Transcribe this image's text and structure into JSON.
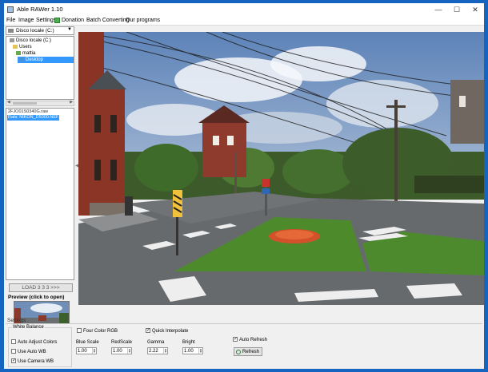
{
  "window": {
    "title": "Able RAWer 1.10"
  },
  "titlebar_controls": {
    "minimize": "—",
    "maximize": "☐",
    "close": "✕"
  },
  "menu": [
    "File",
    "Image",
    "Settings",
    "Donation",
    "Batch Converting",
    "Our programs"
  ],
  "drive_select": {
    "value": "Disco locale (C:)"
  },
  "folder_tree": [
    {
      "label": "Disco locale (C:)",
      "selected": false
    },
    {
      "label": "Users",
      "selected": false
    },
    {
      "label": "mattia",
      "selected": false
    },
    {
      "label": "Desktop",
      "selected": true
    }
  ],
  "files": [
    {
      "name": "2FJO01S0340G.raw",
      "selected": false
    },
    {
      "name": "Rafa' NIKON_D5000.NEF",
      "selected": true
    }
  ],
  "load_button": {
    "label": "LOAD 3 3 3 >>>"
  },
  "preview": {
    "label": "Preview (click to open)"
  },
  "settings": {
    "section_label": "Settings",
    "white_balance": {
      "title": "White Balance",
      "options": [
        {
          "label": "Auto Adjust Colors",
          "checked": false
        },
        {
          "label": "Use Auto WB",
          "checked": false
        },
        {
          "label": "Use Camera WB",
          "checked": true
        }
      ]
    },
    "four_color_rgb": {
      "label": "Four Color RGB",
      "checked": false
    },
    "quick_interpolate": {
      "label": "Quick Interpolate",
      "checked": true
    },
    "fields": [
      {
        "label": "Blue Scale",
        "value": "1.00"
      },
      {
        "label": "RedScale",
        "value": "1.00"
      },
      {
        "label": "Gamma",
        "value": "2.22"
      },
      {
        "label": "Bright",
        "value": "1.00"
      }
    ],
    "auto_refresh": {
      "label": "Auto Refresh",
      "checked": true
    },
    "refresh_button": {
      "label": "Refresh"
    }
  },
  "colors": {
    "accent_blue": "#1565c0",
    "selection": "#3399ff"
  }
}
